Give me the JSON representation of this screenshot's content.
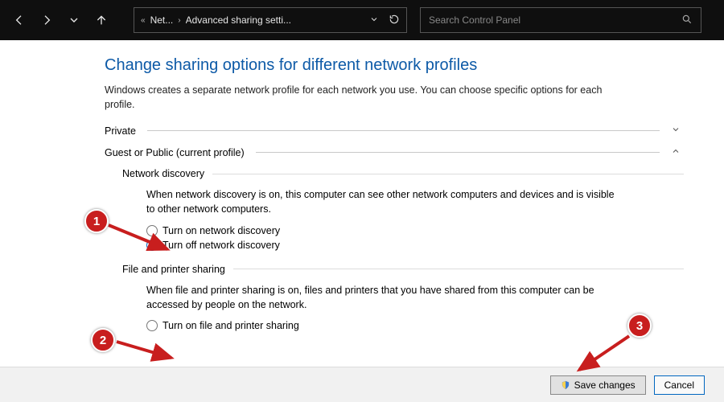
{
  "nav": {
    "breadcrumb_prefix": "Net...",
    "breadcrumb_current": "Advanced sharing setti...",
    "search_placeholder": "Search Control Panel"
  },
  "page": {
    "title": "Change sharing options for different network profiles",
    "description": "Windows creates a separate network profile for each network you use. You can choose specific options for each profile."
  },
  "sections": {
    "private_label": "Private",
    "public_label": "Guest or Public (current profile)"
  },
  "network_discovery": {
    "header": "Network discovery",
    "desc": "When network discovery is on, this computer can see other network computers and devices and is visible to other network computers.",
    "radio_on": "Turn on network discovery",
    "radio_off": "Turn off network discovery"
  },
  "file_printer": {
    "header": "File and printer sharing",
    "desc": "When file and printer sharing is on, files and printers that you have shared from this computer can be accessed by people on the network.",
    "radio_on": "Turn on file and printer sharing"
  },
  "buttons": {
    "save": "Save changes",
    "cancel": "Cancel"
  },
  "annotations": {
    "c1": "1",
    "c2": "2",
    "c3": "3"
  }
}
